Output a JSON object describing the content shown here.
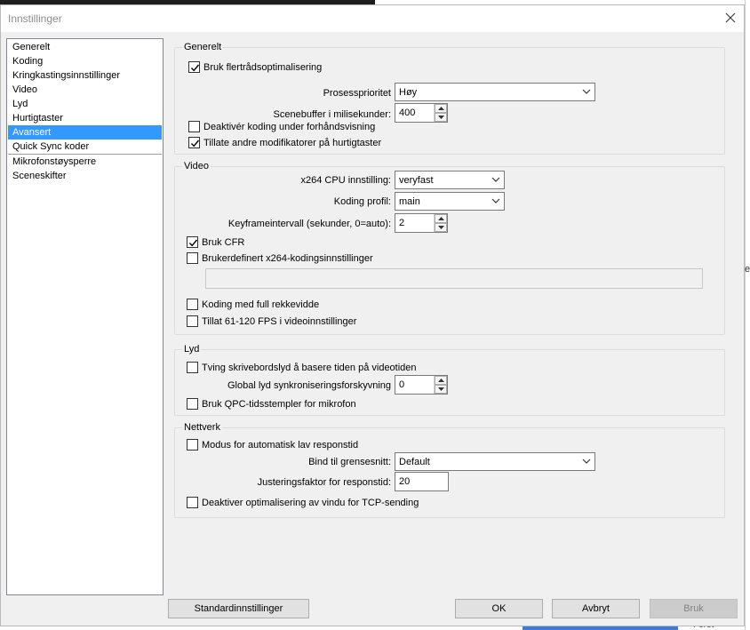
{
  "window": {
    "title": "Innstillinger"
  },
  "sidebar": {
    "items": [
      {
        "label": "Generelt"
      },
      {
        "label": "Koding"
      },
      {
        "label": "Kringkastingsinnstillinger"
      },
      {
        "label": "Video"
      },
      {
        "label": "Lyd"
      },
      {
        "label": "Hurtigtaster"
      },
      {
        "label": "Avansert",
        "selected": true
      },
      {
        "label": "Quick Sync koder"
      },
      {
        "label": "Mikrofonstøysperre"
      },
      {
        "label": "Sceneskifter"
      }
    ]
  },
  "general": {
    "legend": "Generelt",
    "multithread": {
      "label": "Bruk flertrådsoptimalisering",
      "checked": true
    },
    "priority": {
      "label": "Prosessprioritet",
      "value": "Høy"
    },
    "scene_buffer": {
      "label": "Scenebuffer i milisekunder:",
      "value": "400"
    },
    "disable_preview_encoding": {
      "label": "Deaktivér koding under forhåndsvisning",
      "checked": false
    },
    "allow_modifiers": {
      "label": "Tillate andre modifikatorer på hurtigtaster",
      "checked": true
    }
  },
  "video": {
    "legend": "Video",
    "x264_cpu": {
      "label": "x264 CPU innstilling:",
      "value": "veryfast"
    },
    "profile": {
      "label": "Koding profil:",
      "value": "main"
    },
    "keyframe": {
      "label": "Keyframeintervall (sekunder, 0=auto):",
      "value": "2"
    },
    "cfr": {
      "label": "Bruk CFR",
      "checked": true
    },
    "custom_x264": {
      "label": "Brukerdefinert x264-kodingsinnstillinger",
      "checked": false,
      "value": ""
    },
    "full_range": {
      "label": "Koding med full rekkevidde",
      "checked": false
    },
    "fps_61_120": {
      "label": "Tillat 61-120 FPS i videoinnstillinger",
      "checked": false
    }
  },
  "audio": {
    "legend": "Lyd",
    "desktop_timing": {
      "label": "Tving skrivebordslyd å basere tiden på videotiden",
      "checked": false
    },
    "sync_offset": {
      "label": "Global lyd synkroniseringsforskyvning",
      "value": "0"
    },
    "qpc_mic": {
      "label": "Bruk QPC-tidsstempler for mikrofon",
      "checked": false
    }
  },
  "network": {
    "legend": "Nettverk",
    "low_latency": {
      "label": "Modus for automatisk lav responstid",
      "checked": false
    },
    "bind_interface": {
      "label": "Bind til grensesnitt:",
      "value": "Default"
    },
    "latency_factor": {
      "label": "Justeringsfaktor for responstid:",
      "value": "20"
    },
    "tcp_window": {
      "label": "Deaktiver optimalisering av vindu for TCP-sending",
      "checked": false
    }
  },
  "buttons": {
    "defaults": "Standardinnstillinger",
    "ok": "OK",
    "cancel": "Avbryt",
    "apply": "Bruk"
  },
  "background": {
    "edge_glyph": "e",
    "bottom_fragment": "Forot"
  }
}
